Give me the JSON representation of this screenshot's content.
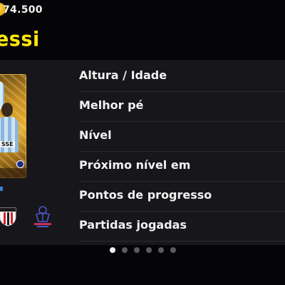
{
  "header": {
    "coins": "74.500",
    "coin_icon": "gold-coin-icon",
    "player_name": "essi"
  },
  "card": {
    "name_on_card": "SSE"
  },
  "stats": [
    {
      "label": "Altura / Idade"
    },
    {
      "label": "Melhor pé"
    },
    {
      "label": "Nível"
    },
    {
      "label": "Próximo nível em"
    },
    {
      "label": "Pontos de progresso"
    },
    {
      "label": "Partidas jogadas"
    }
  ],
  "pagination": {
    "total": 6,
    "active_index": 0
  },
  "colors": {
    "accent_yellow": "#ffe60a",
    "panel": "#17171b",
    "background": "#050507"
  }
}
